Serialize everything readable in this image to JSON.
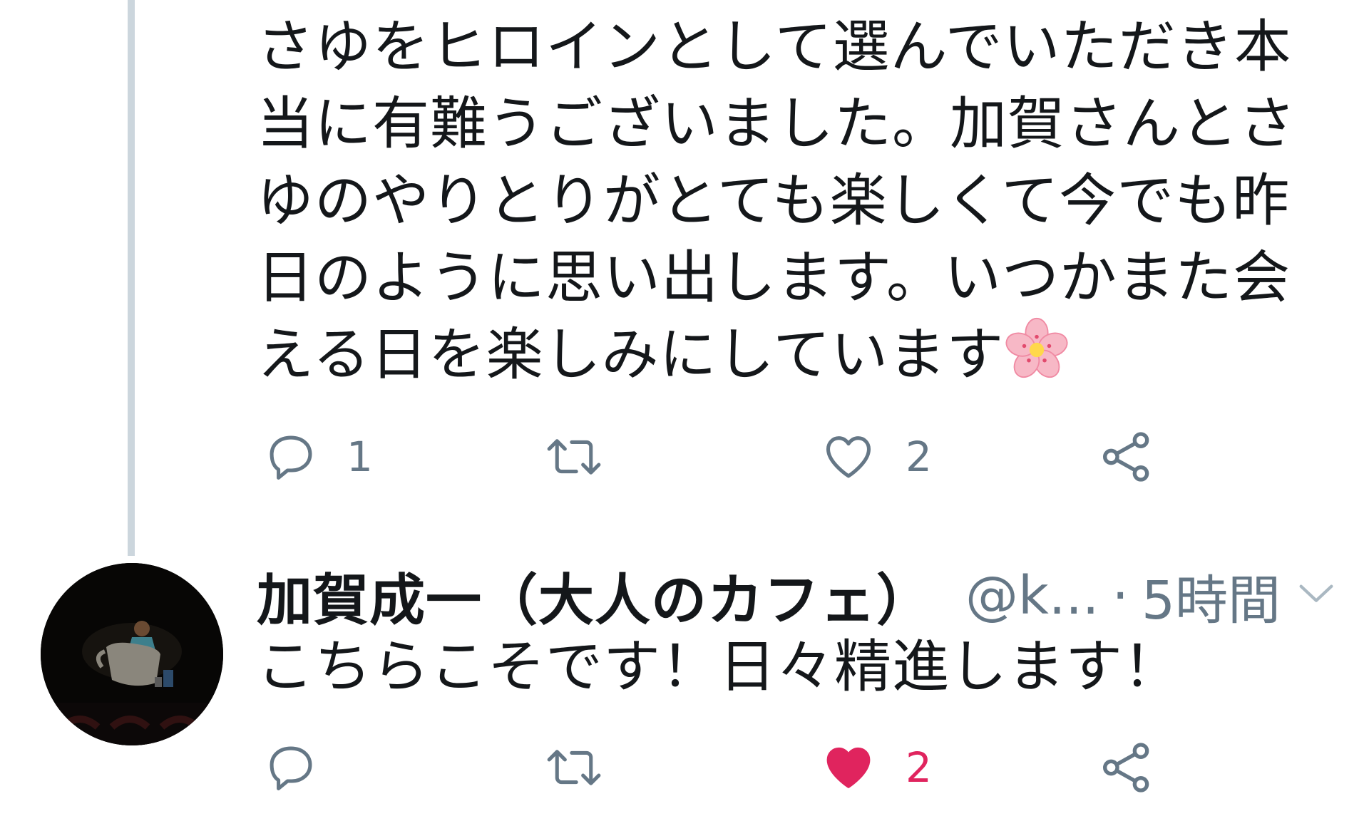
{
  "tweet": {
    "text": "さゆをヒロインとして選んでいただき本当に有難うございました。加賀さんとさゆのやりとりがとても楽しくて今でも昨日のように思い出します。いつかまた会える日を楽しみにしています",
    "emoji": "cherry-blossom",
    "actions": {
      "reply_count": "1",
      "retweet_count": "",
      "like_count": "2",
      "liked": false
    }
  },
  "reply": {
    "display_name": "加賀成一（大人のカフェ）",
    "handle": "@k...",
    "separator": "·",
    "time": "5時間",
    "text": "こちらこそです！日々精進します！",
    "actions": {
      "reply_count": "",
      "retweet_count": "",
      "like_count": "2",
      "liked": true
    }
  },
  "colors": {
    "icon_gray": "#657786",
    "like_red": "#e0245e",
    "thread_line": "#ccd6dd",
    "text": "#14171a"
  }
}
